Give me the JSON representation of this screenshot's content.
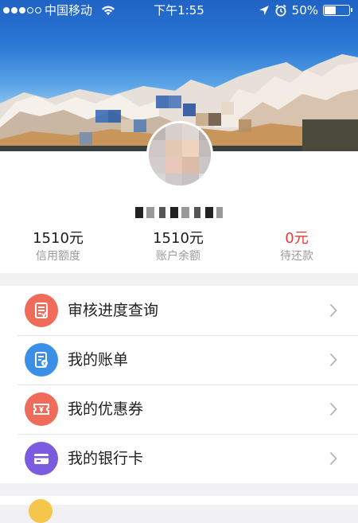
{
  "status_bar": {
    "carrier": "中国移动",
    "time": "下午1:55",
    "battery": "50%",
    "battery_level": 0.5,
    "signal_bars_filled": 3,
    "signal_bars_total": 5,
    "icons": [
      "signal-icon",
      "wifi-icon",
      "location-arrow-icon",
      "alarm-icon",
      "battery-icon"
    ]
  },
  "profile": {
    "stats": [
      {
        "value": "1510元",
        "label": "信用额度",
        "color": "#1a1a1a"
      },
      {
        "value": "1510元",
        "label": "账户余额",
        "color": "#1a1a1a"
      },
      {
        "value": "0元",
        "label": "待还款",
        "color": "#e53935"
      }
    ]
  },
  "menu": {
    "items": [
      {
        "label": "审核进度查询",
        "icon": "review-progress-icon",
        "color": "#ef6b5a"
      },
      {
        "label": "我的账单",
        "icon": "bill-icon",
        "color": "#3b8fe6"
      },
      {
        "label": "我的优惠券",
        "icon": "coupon-icon",
        "color": "#ef6b5a"
      },
      {
        "label": "我的银行卡",
        "icon": "bank-card-icon",
        "color": "#7b5ce0"
      }
    ]
  }
}
